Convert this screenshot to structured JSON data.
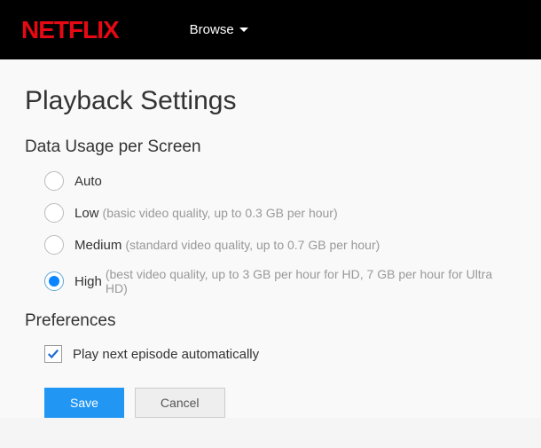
{
  "header": {
    "logo_text": "NETFLIX",
    "browse_label": "Browse"
  },
  "page": {
    "title": "Playback Settings"
  },
  "data_usage": {
    "section_title": "Data Usage per Screen",
    "options": [
      {
        "label": "Auto",
        "desc": "",
        "selected": false
      },
      {
        "label": "Low",
        "desc": "(basic video quality, up to 0.3 GB per hour)",
        "selected": false
      },
      {
        "label": "Medium",
        "desc": "(standard video quality, up to 0.7 GB per hour)",
        "selected": false
      },
      {
        "label": "High",
        "desc": "(best video quality, up to 3 GB per hour for HD, 7 GB per hour for Ultra HD)",
        "selected": true
      }
    ]
  },
  "preferences": {
    "section_title": "Preferences",
    "autoplay_label": "Play next episode automatically",
    "autoplay_checked": true
  },
  "actions": {
    "save": "Save",
    "cancel": "Cancel"
  }
}
